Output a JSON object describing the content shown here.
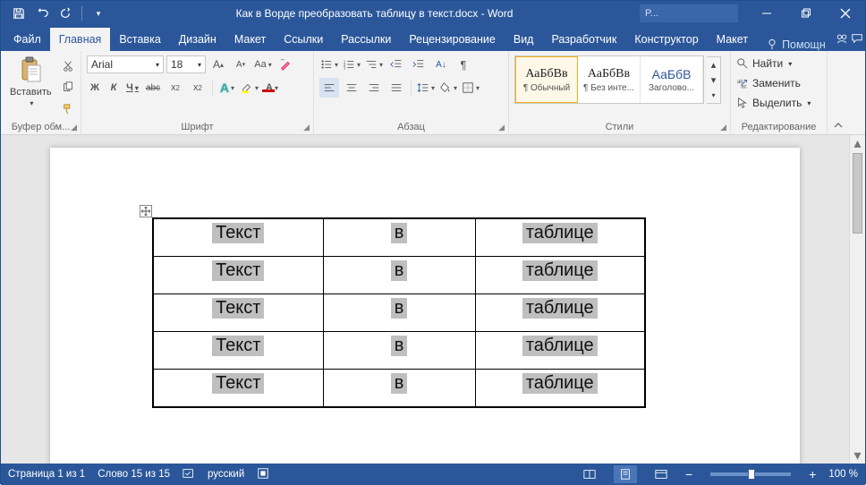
{
  "title": "Как в Ворде преобразовать таблицу в текст.docx - Word",
  "user_badge": "P...",
  "tabs": {
    "file": "Файл",
    "home": "Главная",
    "insert": "Вставка",
    "design": "Дизайн",
    "layout": "Макет",
    "references": "Ссылки",
    "mailings": "Рассылки",
    "review": "Рецензирование",
    "view": "Вид",
    "developer": "Разработчик",
    "ctx_design": "Конструктор",
    "ctx_layout": "Макет",
    "tell_me": "Помощн"
  },
  "ribbon": {
    "clipboard": {
      "paste": "Вставить",
      "label": "Буфер обм..."
    },
    "font": {
      "name": "Arial",
      "size": "18",
      "bold": "Ж",
      "italic": "К",
      "underline": "Ч",
      "strike": "abc",
      "label": "Шрифт"
    },
    "paragraph": {
      "label": "Абзац"
    },
    "styles": {
      "label": "Стили",
      "items": [
        {
          "sample": "АаБбВв",
          "name": "¶ Обычный"
        },
        {
          "sample": "АаБбВв",
          "name": "¶ Без инте..."
        },
        {
          "sample": "АаБбВ",
          "name": "Заголово..."
        }
      ]
    },
    "editing": {
      "find": "Найти",
      "replace": "Заменить",
      "select": "Выделить",
      "label": "Редактирование"
    }
  },
  "document": {
    "table": [
      [
        "Текст",
        "в",
        "таблице"
      ],
      [
        "Текст",
        "в",
        "таблице"
      ],
      [
        "Текст",
        "в",
        "таблице"
      ],
      [
        "Текст",
        "в",
        "таблице"
      ],
      [
        "Текст",
        "в",
        "таблице"
      ]
    ]
  },
  "status": {
    "page": "Страница 1 из 1",
    "words": "Слово 15 из 15",
    "lang": "русский",
    "zoom": "100 %"
  }
}
